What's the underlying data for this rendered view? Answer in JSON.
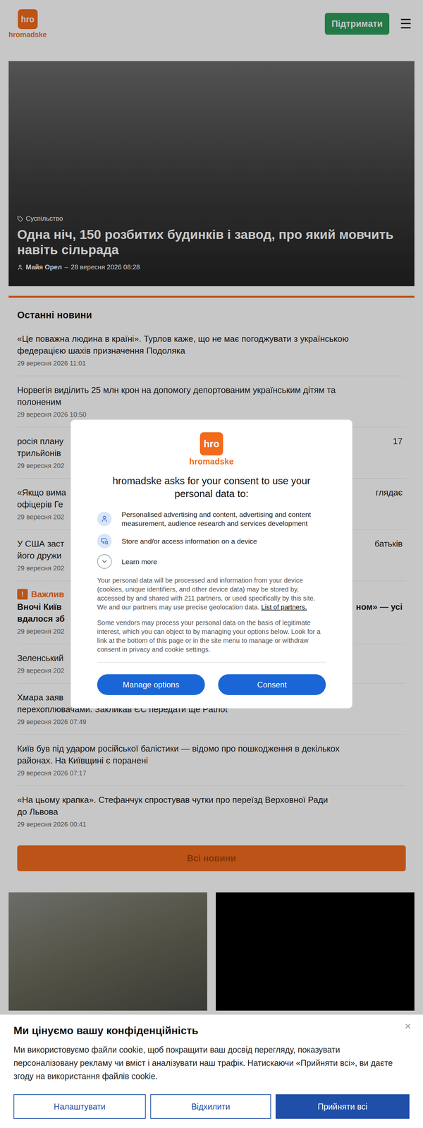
{
  "header": {
    "logo": {
      "mark": "hro",
      "name": "hromadske"
    },
    "support_button": "Підтримати",
    "menu_icon": "☰"
  },
  "hero": {
    "category": "Суспільство",
    "title": "Одна ніч, 150 розбитих будинків і завод, про який мовчить навіть сільрада",
    "author": "Майя Орел",
    "separator": "–",
    "date": "28 вересня 2026 08:28"
  },
  "news": {
    "heading": "Останні новини",
    "items": [
      {
        "important": false,
        "lines": [
          "«Це поважна людина в країні». Турлов каже, що не має погоджувати з українською",
          "федерацією шахів призначення Подоляка"
        ],
        "date": "29 вересня 2026 11:01"
      },
      {
        "important": false,
        "lines": [
          "Норвегія виділить 25 млн крон на допомогу депортованим українським дітям та",
          "полоненим"
        ],
        "date": "29 вересня 2026 10:50"
      },
      {
        "important": false,
        "lines": [
          "росія плану",
          "трильйонів"
        ],
        "tail": "17",
        "date": "29 вересня 202"
      },
      {
        "important": false,
        "lines": [
          "«Якщо вима",
          "офіцерів Ге"
        ],
        "tail": "глядає",
        "date": "29 вересня 202"
      },
      {
        "important": false,
        "lines": [
          "У США заст",
          "його дружи"
        ],
        "tail": "батьків",
        "date": "29 вересня 202"
      },
      {
        "important": true,
        "label": "Важлив",
        "label_icon": "!",
        "lines": [
          "Вночі Київ",
          "вдалося зб"
        ],
        "tail": "ном» — усі",
        "date": "29 вересня 202"
      },
      {
        "important": false,
        "lines": [
          "Зеленський"
        ],
        "date": "29 вересня 202"
      },
      {
        "important": false,
        "lines": [
          "Хмара заяв",
          "перехоплювачами. Закликав ЄС передати ще Patriot"
        ],
        "date": "29 вересня 2026 07:49"
      },
      {
        "important": false,
        "lines": [
          "Київ був під ударом російської балістики — відомо про пошкодження в декількох",
          "районах. На Київщині є поранені"
        ],
        "date": "29 вересня 2026 07:17"
      },
      {
        "important": false,
        "lines": [
          "«На цьому крапка». Стефанчук спростував чутки про переїзд Верховної Ради",
          "до Львова"
        ],
        "date": "29 вересня 2026 00:41"
      }
    ],
    "all_button": "Всі новини"
  },
  "cards": [
    {
      "kind": "photo"
    },
    {
      "kind": "game"
    }
  ],
  "consent_modal": {
    "logo": {
      "mark": "hro",
      "name": "hromadske"
    },
    "title": "hromadske asks for your consent to use your personal data to:",
    "purposes": [
      {
        "kind": "person",
        "text": "Personalised advertising and content, advertising and content measurement, audience research and services development",
        "expanded": false
      },
      {
        "kind": "device",
        "text": "Store and/or access information on a device",
        "expanded": false
      },
      {
        "kind": "more",
        "text": "Learn more",
        "expanded": false
      }
    ],
    "paragraph1": "Your personal data will be processed and information from your device (cookies, unique identifiers, and other device data) may be stored by, accessed by and shared with 211 partners, or used specifically by this site. We and our partners may use precise geolocation data.",
    "partners_link": "List of partners.",
    "paragraph2": "Some vendors may process your personal data on the basis of legitimate interest, which you can object to by managing your options below. Look for a link at the bottom of this page or in the site menu to manage or withdraw consent in privacy and cookie settings.",
    "buttons": [
      "Manage options",
      "Consent"
    ]
  },
  "cookie_banner": {
    "title": "Ми цінуємо вашу конфіденційність",
    "close": "×",
    "text": "Ми використовуємо файли cookie, щоб покращити ваш досвід перегляду, показувати персоналізовану рекламу чи вміст і аналізувати наш трафік. Натискаючи «Прийняти всі», ви даєте згоду на використання файлів cookie.",
    "buttons": [
      {
        "label": "Налаштувати",
        "primary": false
      },
      {
        "label": "Відхилити",
        "primary": false
      },
      {
        "label": "Прийняти всі",
        "primary": true
      }
    ]
  }
}
